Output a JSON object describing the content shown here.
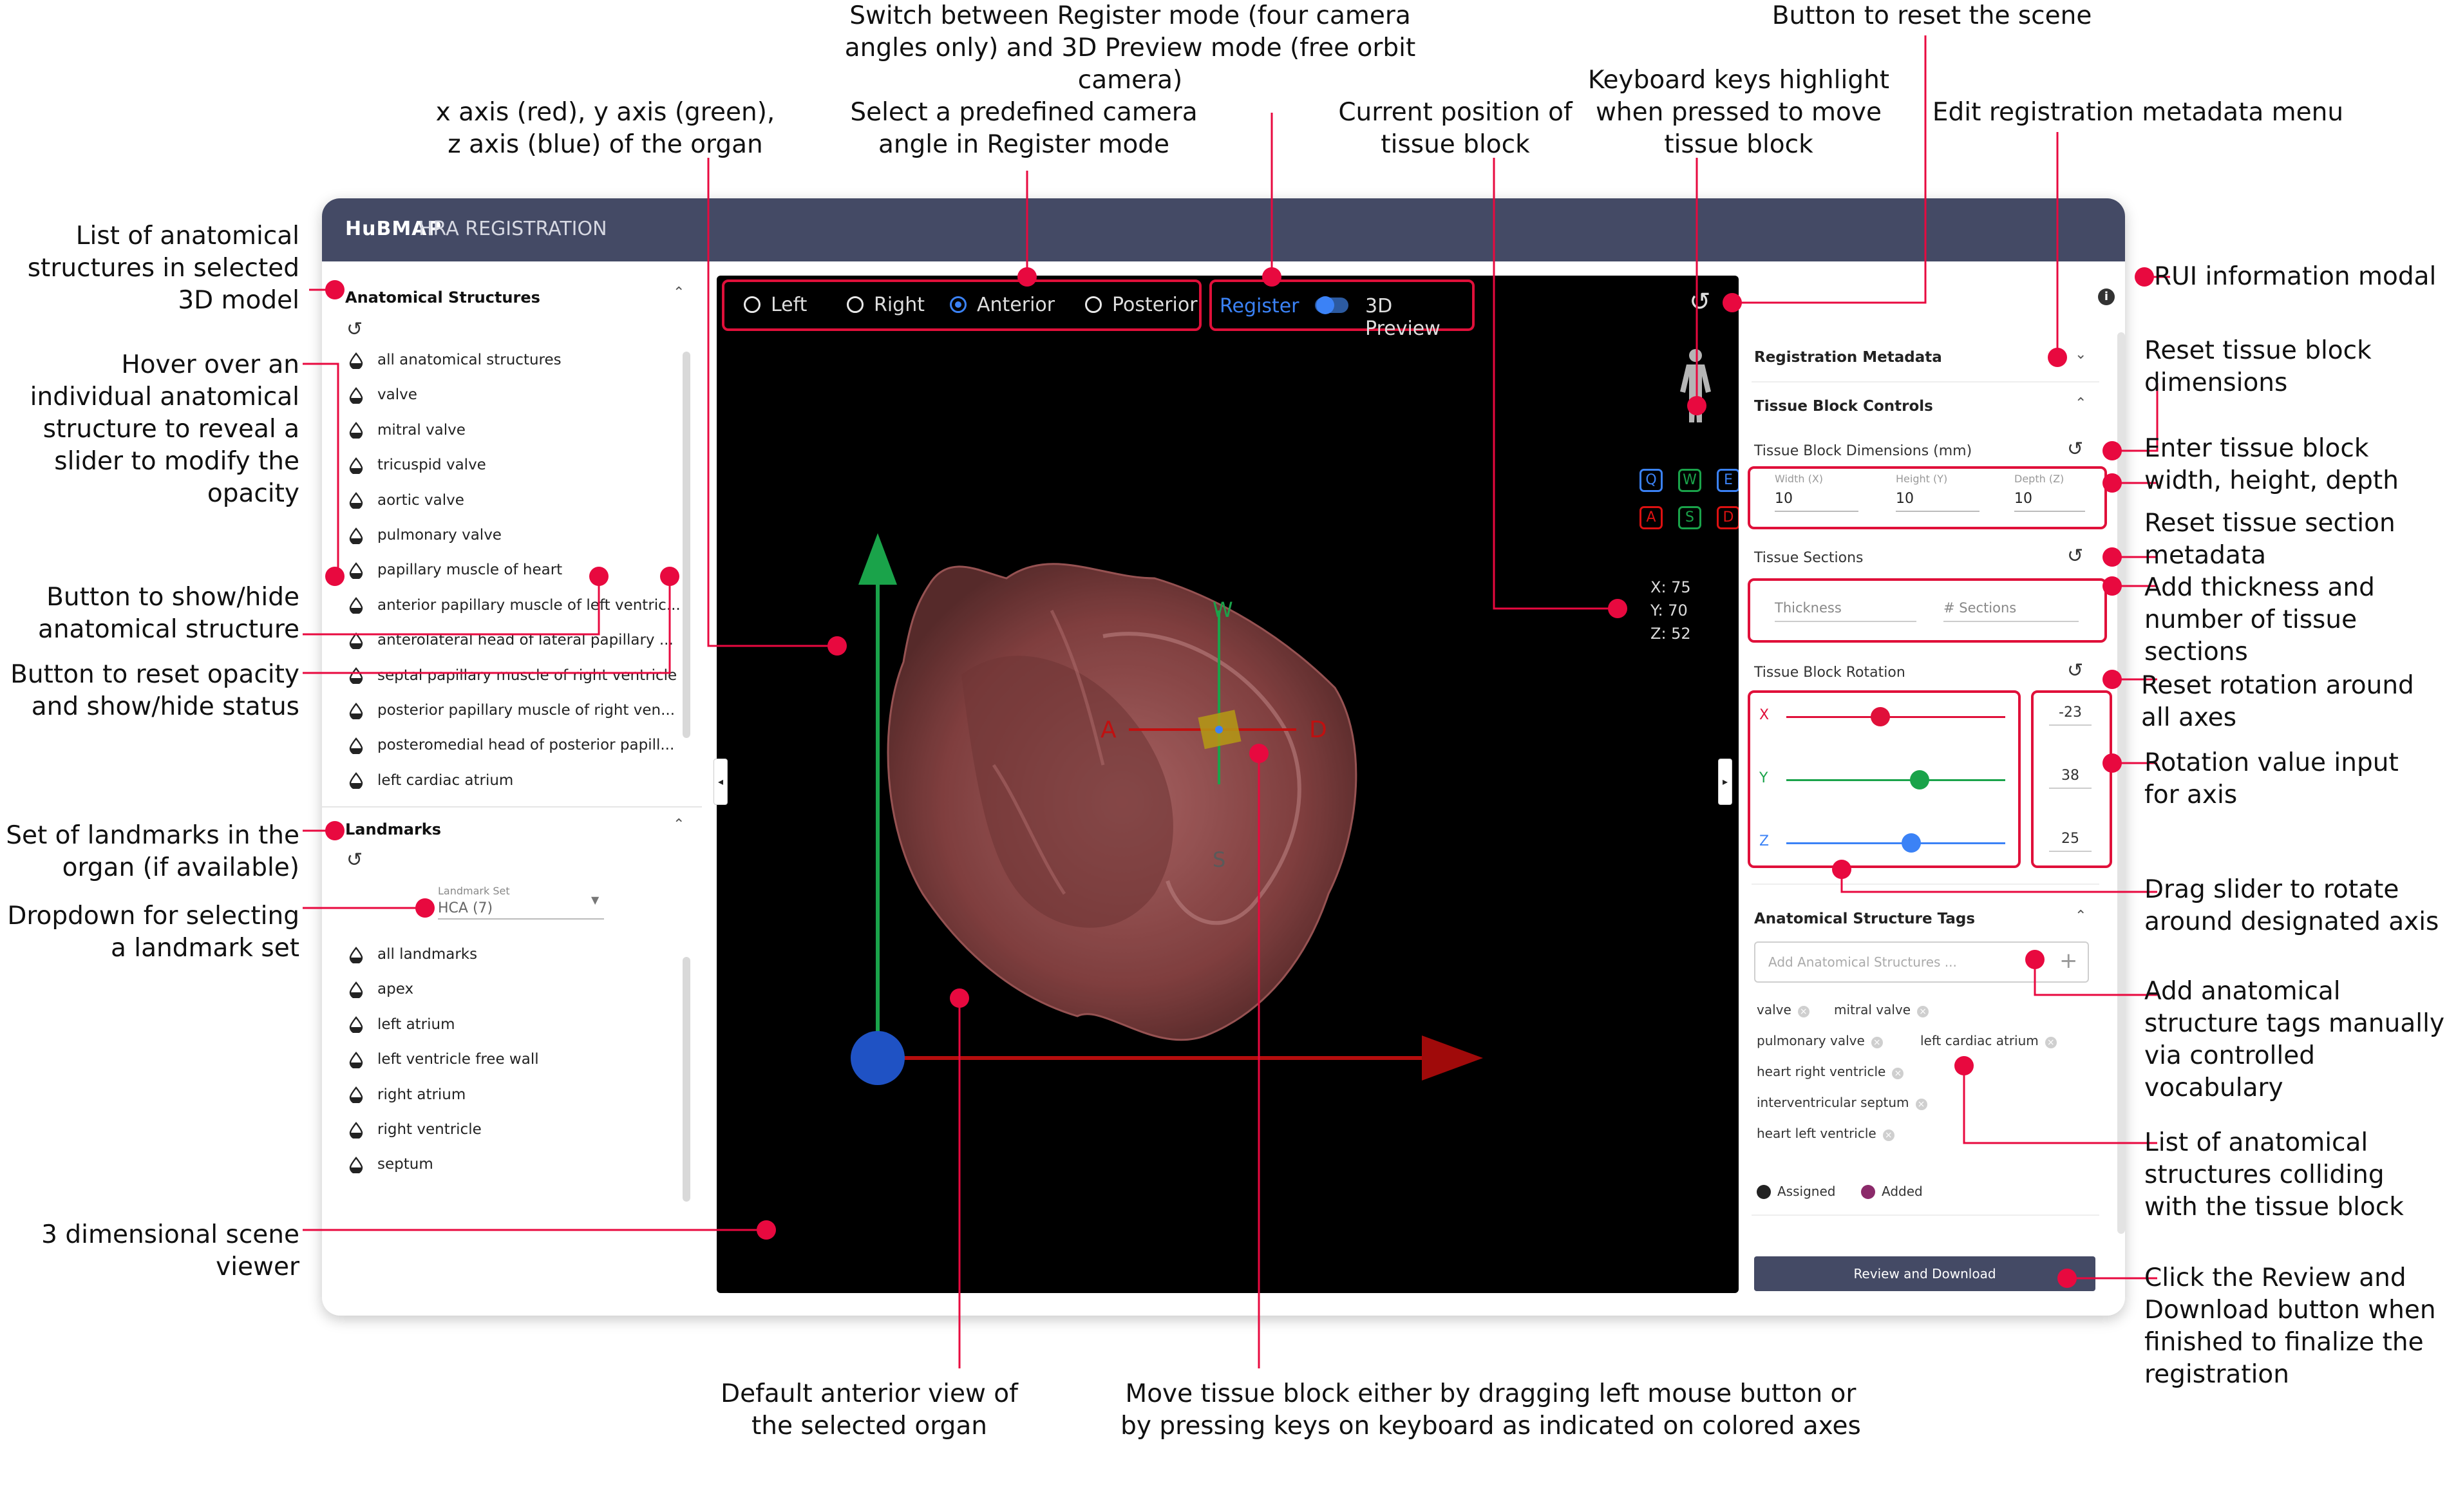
{
  "app": {
    "brand": "HuBMAP",
    "title": "HRA REGISTRATION"
  },
  "sidebar": {
    "anatomical": {
      "title": "Anatomical Structures",
      "items": [
        "all anatomical structures",
        "valve",
        "mitral valve",
        "tricuspid valve",
        "aortic valve",
        "pulmonary valve",
        "papillary muscle of heart",
        "anterior papillary muscle of left ventric...",
        "anterolateral head of lateral papillary ...",
        "septal papillary muscle of right ventricle",
        "posterior papillary muscle of right ven...",
        "posteromedial head of posterior papill...",
        "left cardiac atrium"
      ]
    },
    "landmarks": {
      "title": "Landmarks",
      "set_label": "Landmark Set",
      "set_value": "HCA (7)",
      "items": [
        "all landmarks",
        "apex",
        "left atrium",
        "left ventricle free wall",
        "right atrium",
        "right ventricle",
        "septum"
      ]
    }
  },
  "viewer": {
    "views": [
      "Left",
      "Right",
      "Anterior",
      "Posterior"
    ],
    "selected_view": "Anterior",
    "mode_register": "Register",
    "mode_preview": "3D Preview",
    "keys_top": [
      "Q",
      "W",
      "E"
    ],
    "keys_bottom": [
      "A",
      "S",
      "D"
    ],
    "position": {
      "x": "X: 75",
      "y": "Y: 70",
      "z": "Z: 52"
    },
    "axis_labels": {
      "w": "W",
      "a": "A",
      "d": "D",
      "s": "S"
    }
  },
  "panel": {
    "metadata_title": "Registration Metadata",
    "controls_title": "Tissue Block Controls",
    "dimensions_label": "Tissue Block Dimensions (mm)",
    "width_label": "Width (X)",
    "width_value": "10",
    "height_label": "Height (Y)",
    "height_value": "10",
    "depth_label": "Depth (Z)",
    "depth_value": "10",
    "sections_label": "Tissue Sections",
    "thickness_placeholder": "Thickness",
    "sections_placeholder": "# Sections",
    "rotation_label": "Tissue Block Rotation",
    "rotation": [
      {
        "axis": "X",
        "value": "-23",
        "level": 0.43
      },
      {
        "axis": "Y",
        "value": "38",
        "level": 0.61
      },
      {
        "axis": "Z",
        "value": "25",
        "level": 0.57
      }
    ],
    "tags_title": "Anatomical Structure Tags",
    "tags_placeholder": "Add Anatomical Structures ...",
    "tags": [
      "valve",
      "mitral valve",
      "pulmonary valve",
      "left cardiac atrium",
      "heart right ventricle",
      "interventricular septum",
      "heart left ventricle"
    ],
    "legend_assigned": "Assigned",
    "legend_added": "Added",
    "review_button": "Review and Download"
  },
  "annotations": {
    "list_structures": "List of anatomical structures in selected 3D model",
    "hover_slider": "Hover over an individual anatomical structure to reveal a slider to modify the opacity",
    "show_hide": "Button to show/hide anatomical structure",
    "reset_opacity": "Button to reset opacity and show/hide status",
    "landmarks_set": "Set of landmarks in the organ (if available)",
    "landmark_dropdown": "Dropdown for selecting a landmark set",
    "scene_viewer": "3 dimensional scene viewer",
    "axes": "x axis (red), y axis (green), z axis (blue) of the organ",
    "camera_angle": "Select a predefined camera angle in Register mode",
    "switch_mode": "Switch between Register mode (four camera angles only) and 3D Preview mode (free orbit camera)",
    "current_position": "Current position of tissue block",
    "keyboard_keys": "Keyboard keys highlight when pressed to move tissue block",
    "reset_scene": "Button to reset the scene",
    "edit_metadata": "Edit registration metadata menu",
    "rui_info": "RUI information modal",
    "reset_dimensions": "Reset tissue block dimensions",
    "enter_dimensions": "Enter tissue block width, height, depth",
    "reset_sections": "Reset tissue section metadata",
    "add_thickness": "Add thickness and number of tissue sections",
    "reset_rotation": "Reset rotation around all axes",
    "rotation_input": "Rotation value input for axis",
    "drag_slider": "Drag slider to rotate around designated axis",
    "add_tags": "Add anatomical structure tags manually via controlled vocabulary",
    "colliding_list": "List of anatomical structures colliding with the tissue block",
    "review_download": "Click the Review and Download button when finished to finalize the registration",
    "default_view": "Default anterior view of the selected organ",
    "move_block": "Move tissue block either by dragging left mouse button or by pressing keys on keyboard as indicated on colored axes"
  }
}
